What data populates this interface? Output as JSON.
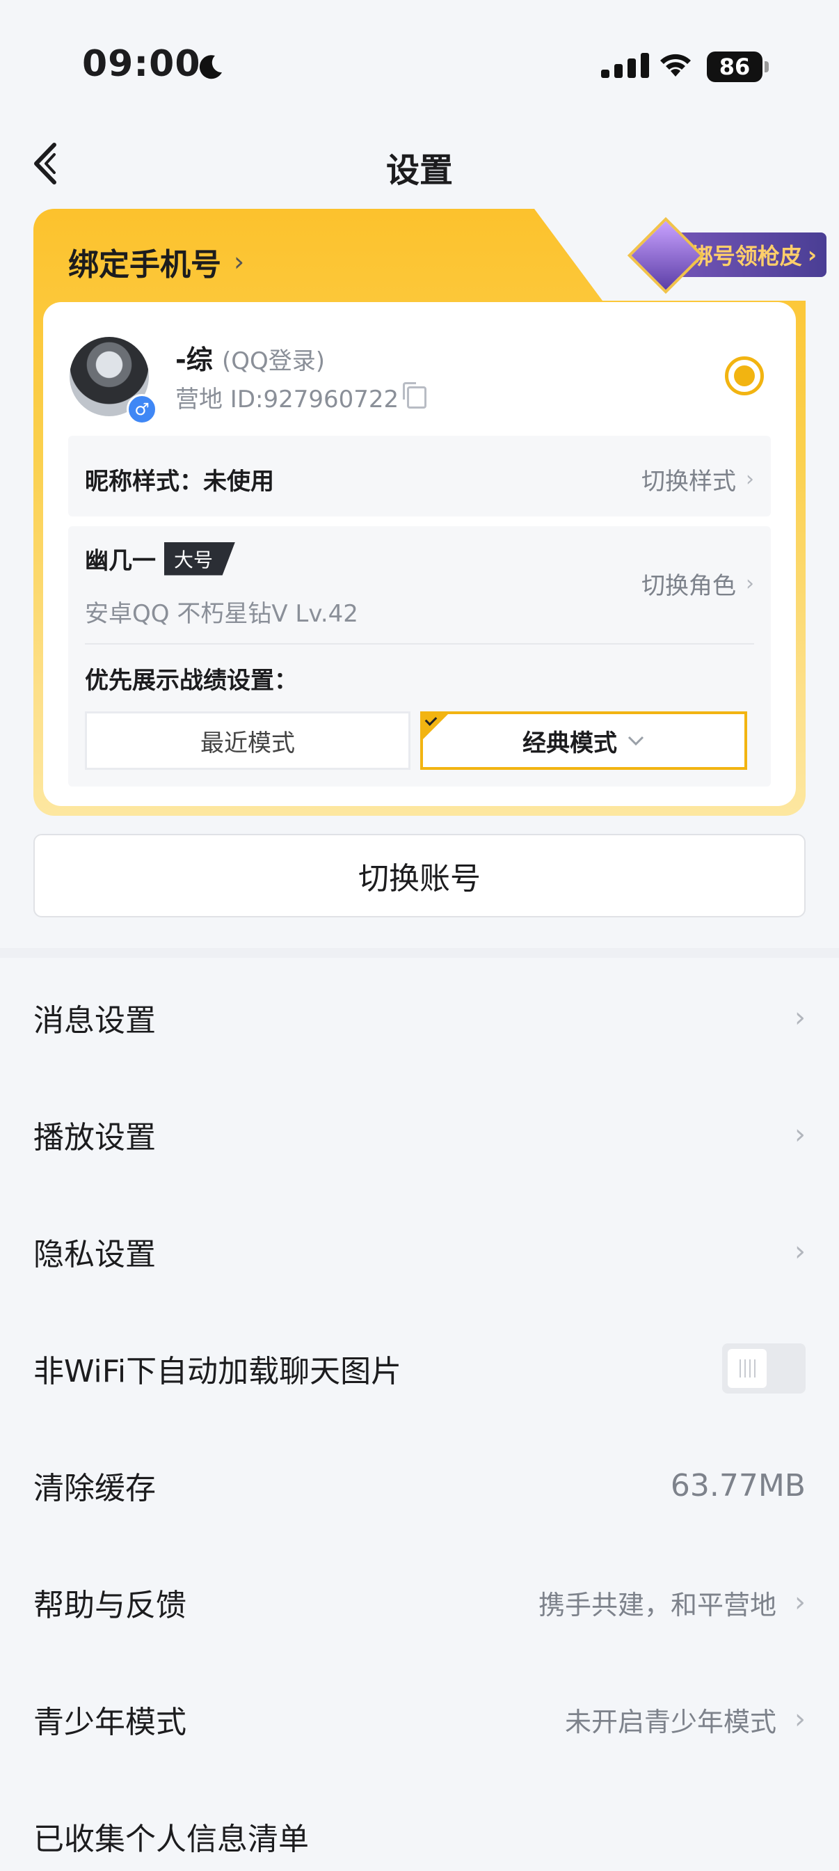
{
  "status_bar": {
    "time": "09:00",
    "battery": "86"
  },
  "nav": {
    "title": "设置"
  },
  "account_card": {
    "bind_phone_label": "绑定手机号",
    "promo_label": "绑号领枪皮",
    "user_name": "-综",
    "login_type": "(QQ登录)",
    "camp_id": "营地 ID:927960722",
    "nickname_style_label": "昵称样式：未使用",
    "switch_style_label": "切换样式",
    "role_name": "幽几一",
    "role_tag": "大号",
    "role_meta": "安卓QQ  不朽星钻V  Lv.42",
    "switch_role_label": "切换角色",
    "pref_label": "优先展示战绩设置：",
    "mode_recent": "最近模式",
    "mode_classic": "经典模式"
  },
  "switch_account_label": "切换账号",
  "menu": [
    {
      "label": "消息设置"
    },
    {
      "label": "播放设置"
    },
    {
      "label": "隐私设置"
    },
    {
      "label": "非WiFi下自动加载聊天图片",
      "toggle": false
    },
    {
      "label": "清除缓存",
      "value": "63.77MB"
    },
    {
      "label": "帮助与反馈",
      "value": "携手共建，和平营地"
    },
    {
      "label": "青少年模式",
      "value": "未开启青少年模式"
    },
    {
      "label": "已收集个人信息清单"
    }
  ],
  "colors": {
    "accent": "#f2b411",
    "card_yellow": "#fcc22d",
    "promo": "#5b46a6"
  }
}
